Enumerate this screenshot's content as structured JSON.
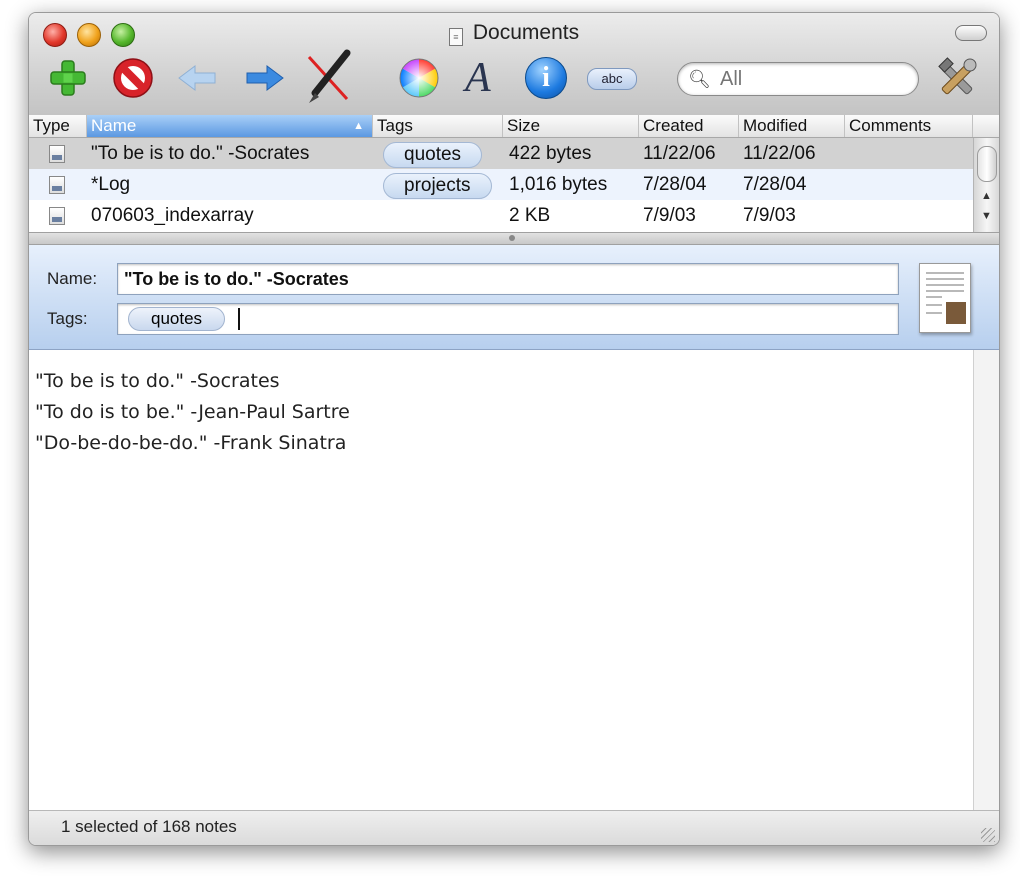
{
  "window": {
    "title": "Documents"
  },
  "search": {
    "placeholder": "All"
  },
  "columns": [
    "Type",
    "Name",
    "Tags",
    "Size",
    "Created",
    "Modified",
    "Comments"
  ],
  "rows": [
    {
      "name": "\"To be is to do.\" -Socrates",
      "tag": "quotes",
      "size": "422 bytes",
      "created": "11/22/06",
      "modified": "11/22/06"
    },
    {
      "name": "*Log",
      "tag": "projects",
      "size": "1,016 bytes",
      "created": "7/28/04",
      "modified": "7/28/04"
    },
    {
      "name": "070603_indexarray",
      "tag": "",
      "size": "2 KB",
      "created": "7/9/03",
      "modified": "7/9/03"
    }
  ],
  "info": {
    "name_label": "Name:",
    "name_value": "\"To be is to do.\" -Socrates",
    "tags_label": "Tags:",
    "tag_token": "quotes"
  },
  "note_lines": [
    "\"To be is to do.\" -Socrates",
    "\"To do is to be.\" -Jean-Paul Sartre",
    "\"Do-be-do-be-do.\" -Frank Sinatra"
  ],
  "status": "1 selected of 168 notes",
  "toolbar": {
    "font_glyph": "A",
    "info_glyph": "i",
    "spell_label": "abc"
  },
  "colors": {
    "selected_row": "#d4d4d4",
    "alt_row": "#edf3fd",
    "header_selected": "#5b98e2",
    "info_panel": "#c9dbf2"
  }
}
